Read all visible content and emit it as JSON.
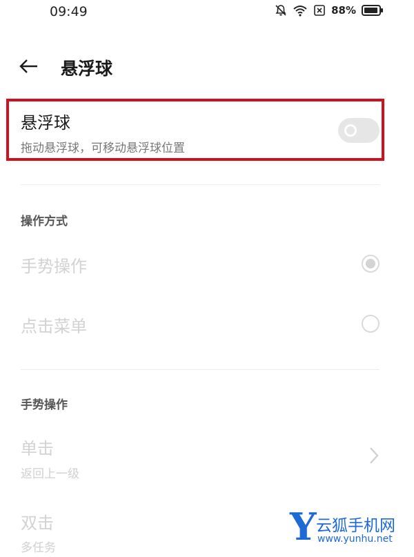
{
  "status_bar": {
    "time": "09:49",
    "battery": "88%",
    "icons": [
      "bell-off-icon",
      "wifi-icon",
      "sim-icon",
      "battery-icon"
    ]
  },
  "header": {
    "back_icon": "arrow-left-icon",
    "title": "悬浮球"
  },
  "floating_ball": {
    "title": "悬浮球",
    "description": "拖动悬浮球，可移动悬浮球位置",
    "enabled": false,
    "highlight_color": "#d0101c"
  },
  "operation_mode": {
    "header": "操作方式",
    "options": [
      {
        "label": "手势操作",
        "selected": true
      },
      {
        "label": "点击菜单",
        "selected": false
      }
    ]
  },
  "gestures": {
    "header": "手势操作",
    "items": [
      {
        "label": "单击",
        "value": "返回上一级"
      },
      {
        "label": "双击",
        "value": "多任务"
      }
    ]
  },
  "watermark": {
    "letter": "Y",
    "name": "云狐手机网",
    "url": "www.yunhu.net",
    "color": "#1d6ad6"
  }
}
